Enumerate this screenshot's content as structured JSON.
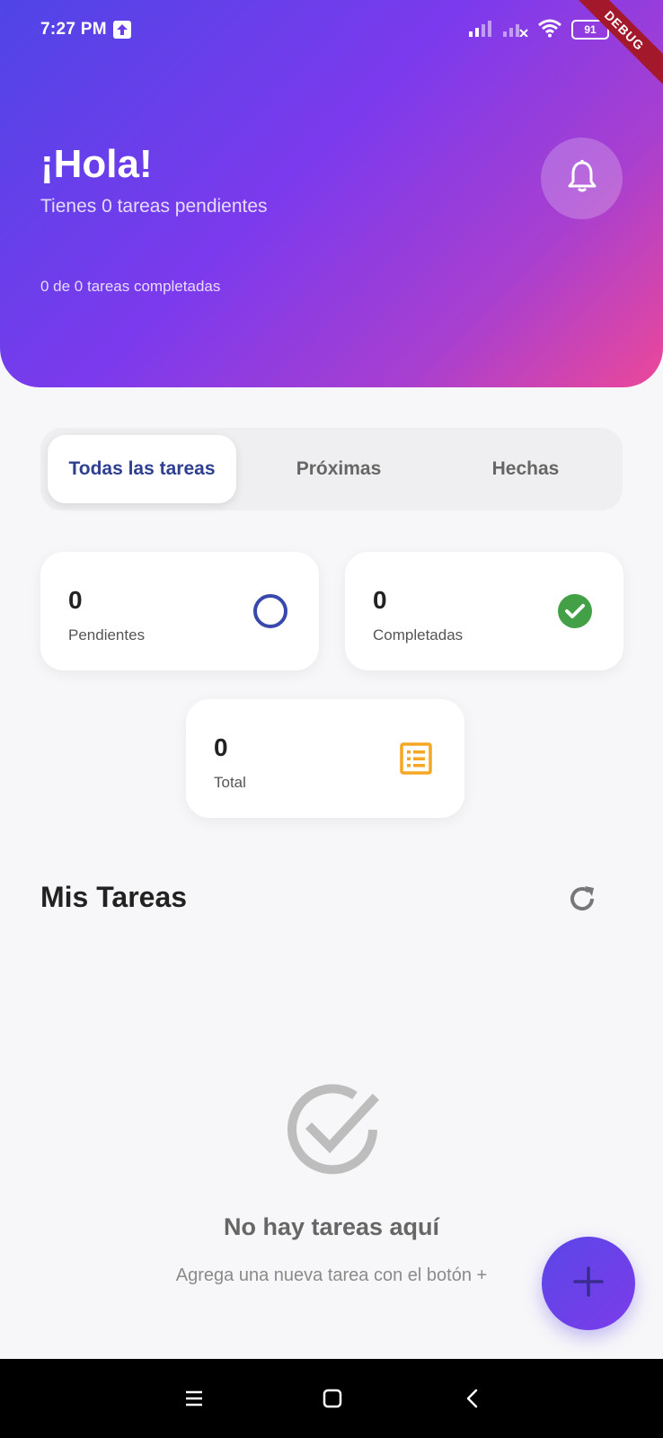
{
  "status_bar": {
    "time": "7:27 PM",
    "battery": "91",
    "debug_label": "DEBUG"
  },
  "header": {
    "greeting": "¡Hola!",
    "subtitle": "Tienes 0 tareas pendientes",
    "progress_text": "0 de 0 tareas completadas",
    "notification_icon": "bell-icon"
  },
  "tabs": [
    {
      "label": "Todas las tareas",
      "active": true
    },
    {
      "label": "Próximas",
      "active": false
    },
    {
      "label": "Hechas",
      "active": false
    }
  ],
  "stats": {
    "pending": {
      "value": "0",
      "label": "Pendientes",
      "icon": "circle-outline-icon",
      "color": "#3949ab"
    },
    "completed": {
      "value": "0",
      "label": "Completadas",
      "icon": "check-circle-icon",
      "color": "#43a047"
    },
    "total": {
      "value": "0",
      "label": "Total",
      "icon": "list-icon",
      "color": "#f5a623"
    }
  },
  "tasks_section": {
    "title": "Mis Tareas",
    "refresh_icon": "refresh-icon"
  },
  "empty_state": {
    "icon": "check-circle-outline-icon",
    "title": "No hay tareas aquí",
    "subtitle": "Agrega una nueva tarea con el botón +"
  },
  "fab": {
    "icon": "plus-icon"
  },
  "colors": {
    "primary": "#5b46e8",
    "accent_pink": "#ec4899",
    "active_tab_text": "#2f3f8f"
  }
}
